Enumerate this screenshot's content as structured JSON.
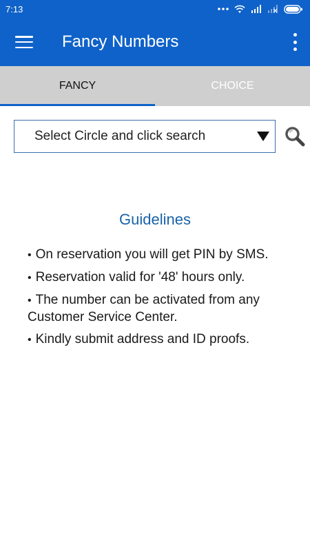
{
  "status_bar": {
    "time": "7:13",
    "icons": [
      "more-dots-icon",
      "wifi-icon",
      "signal-icon",
      "no-signal-icon",
      "battery-icon"
    ]
  },
  "app_bar": {
    "title": "Fancy Numbers",
    "menu_icon": "hamburger-menu-icon",
    "overflow_icon": "overflow-menu-icon"
  },
  "tabs": [
    {
      "label": "FANCY",
      "active": true
    },
    {
      "label": "CHOICE",
      "active": false
    }
  ],
  "circle_select": {
    "value": "Select Circle and click search",
    "search_icon": "magnifier-icon"
  },
  "guidelines": {
    "title": "Guidelines",
    "bullet": "•",
    "items": [
      "On reservation you will get PIN by SMS.",
      "Reservation valid for '48' hours only.",
      "The number can be activated from any Customer Service Center.",
      "Kindly submit address and ID proofs."
    ]
  },
  "colors": {
    "primary": "#0f62c9",
    "tab_bar": "#cfcfcf",
    "guidelines_title": "#1a62a8"
  }
}
